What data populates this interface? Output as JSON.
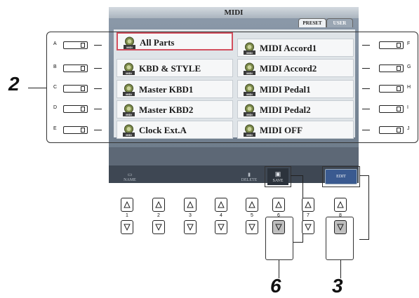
{
  "screen": {
    "title": "MIDI",
    "tabs": [
      {
        "label": "PRESET",
        "active": true
      },
      {
        "label": "USER",
        "active": false
      }
    ]
  },
  "left_column": [
    {
      "key": "A",
      "label": "All Parts",
      "selected": true
    },
    {
      "key": "B",
      "label": "KBD & STYLE",
      "selected": false
    },
    {
      "key": "C",
      "label": "Master KBD1",
      "selected": false
    },
    {
      "key": "D",
      "label": "Master KBD2",
      "selected": false
    },
    {
      "key": "E",
      "label": "Clock Ext.A",
      "selected": false
    }
  ],
  "right_column": [
    {
      "key": "F",
      "label": "MIDI Accord1"
    },
    {
      "key": "G",
      "label": "MIDI Accord2"
    },
    {
      "key": "H",
      "label": "MIDI Pedal1"
    },
    {
      "key": "I",
      "label": "MIDI Pedal2"
    },
    {
      "key": "J",
      "label": "MIDI OFF"
    }
  ],
  "bottom_buttons": {
    "name": "NAME",
    "delete": "DELETE",
    "save": "SAVE",
    "edit": "EDIT"
  },
  "number_buttons": [
    "1",
    "2",
    "3",
    "4",
    "5",
    "6",
    "7",
    "8"
  ],
  "callouts": {
    "step_2": "2",
    "step_6": "6",
    "step_3": "3"
  },
  "colors": {
    "selection_border": "#d24f5e",
    "edit_button": "#3a5a90",
    "screen_bg": "#7e8c9b"
  }
}
